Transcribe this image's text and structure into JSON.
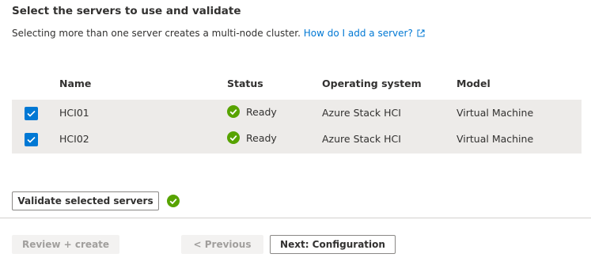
{
  "header": {
    "title": "Select the servers to use and validate",
    "description": "Selecting more than one server creates a multi-node cluster.",
    "help_link": "How do I add a server?"
  },
  "table": {
    "columns": [
      "Name",
      "Status",
      "Operating system",
      "Model"
    ],
    "rows": [
      {
        "checked": true,
        "name": "HCI01",
        "status": "Ready",
        "os": "Azure Stack HCI",
        "model": "Virtual Machine"
      },
      {
        "checked": true,
        "name": "HCI02",
        "status": "Ready",
        "os": "Azure Stack HCI",
        "model": "Virtual Machine"
      }
    ]
  },
  "actions": {
    "validate_label": "Validate selected servers",
    "validate_status": "success"
  },
  "footer": {
    "review_label": "Review + create",
    "previous_label": "< Previous",
    "next_label": "Next: Configuration"
  },
  "colors": {
    "accent": "#0078d4",
    "success": "#57a300",
    "row_bg": "#edebe9"
  }
}
